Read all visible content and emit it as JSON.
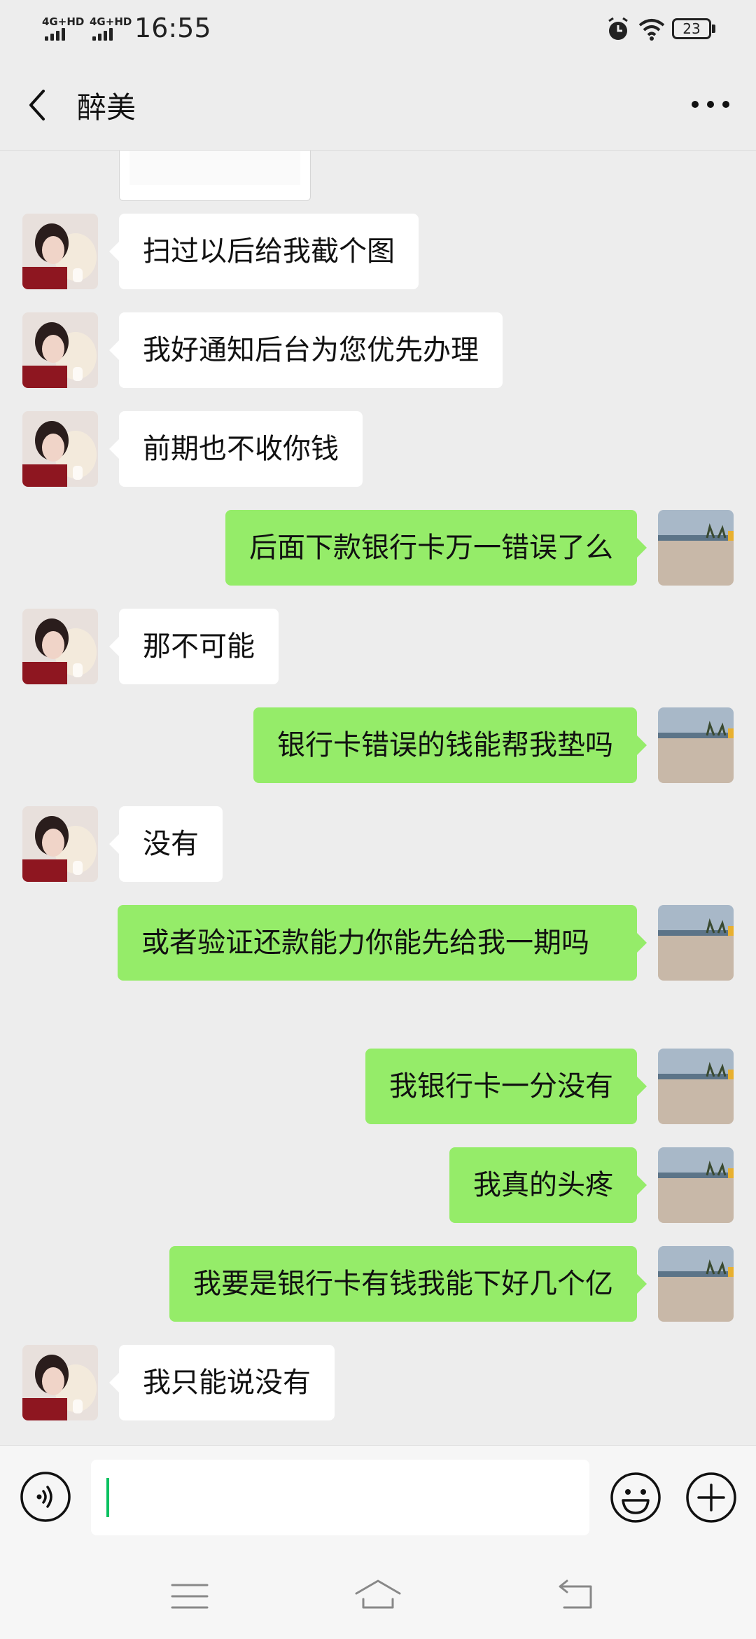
{
  "status_bar": {
    "network_1": "4G+HD",
    "network_2": "4G+HD",
    "time": "16:55",
    "battery": "23",
    "icons": [
      "alarm-icon",
      "wifi-icon",
      "battery-icon"
    ]
  },
  "nav": {
    "title": "醉美",
    "back_icon": "chevron-left-icon",
    "more_icon": "more-dots-icon"
  },
  "messages": [
    {
      "side": "in",
      "text": "扫过以后给我截个图"
    },
    {
      "side": "in",
      "text": "我好通知后台为您优先办理"
    },
    {
      "side": "in",
      "text": "前期也不收你钱"
    },
    {
      "side": "out",
      "text": "后面下款银行卡万一错误了么"
    },
    {
      "side": "in",
      "text": "那不可能"
    },
    {
      "side": "out",
      "text": "银行卡错误的钱能帮我垫吗"
    },
    {
      "side": "in",
      "text": "没有"
    },
    {
      "side": "out",
      "text": "或者验证还款能力你能先给我一期吗"
    },
    {
      "side": "out",
      "text": "我银行卡一分没有"
    },
    {
      "side": "out",
      "text": "我真的头疼"
    },
    {
      "side": "out",
      "text": "我要是银行卡有钱我能下好几个亿"
    },
    {
      "side": "in",
      "text": "我只能说没有"
    }
  ],
  "input_bar": {
    "value": "",
    "voice_icon": "voice-icon",
    "emoji_icon": "emoji-icon",
    "plus_icon": "plus-icon"
  },
  "system_nav": {
    "icons": [
      "menu-icon",
      "home-icon",
      "back-icon"
    ]
  },
  "colors": {
    "background": "#ededed",
    "incoming_bubble": "#ffffff",
    "outgoing_bubble": "#95ec69",
    "cursor": "#07c160"
  }
}
